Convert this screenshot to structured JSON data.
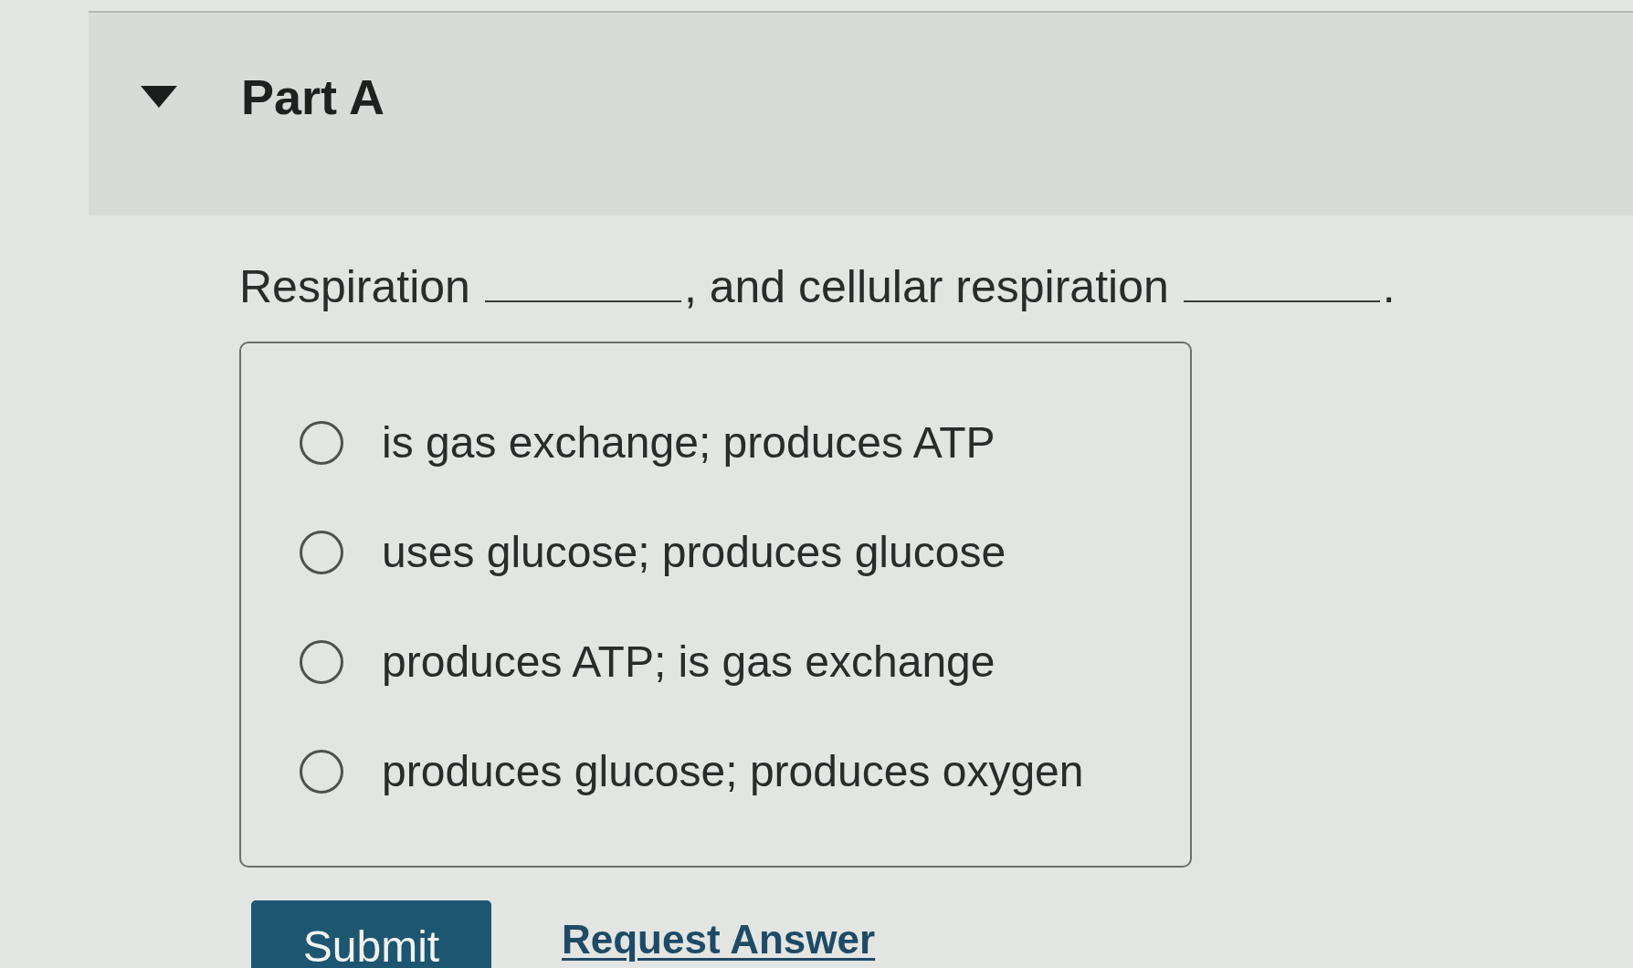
{
  "part": {
    "title": "Part A",
    "expanded": true
  },
  "question": [
    {
      "kind": "text",
      "text": "Respiration"
    },
    {
      "kind": "blank"
    },
    {
      "kind": "text",
      "text": ", and cellular respiration"
    },
    {
      "kind": "blank"
    },
    {
      "kind": "text",
      "text": "."
    }
  ],
  "options": [
    {
      "label": "is gas exchange; produces ATP",
      "selected": false
    },
    {
      "label": "uses glucose; produces glucose",
      "selected": false
    },
    {
      "label": "produces ATP; is gas exchange",
      "selected": false
    },
    {
      "label": "produces glucose; produces oxygen",
      "selected": false
    }
  ],
  "actions": [
    {
      "kind": "primary",
      "label": "Submit"
    },
    {
      "kind": "link",
      "label": "Request Answer"
    }
  ]
}
